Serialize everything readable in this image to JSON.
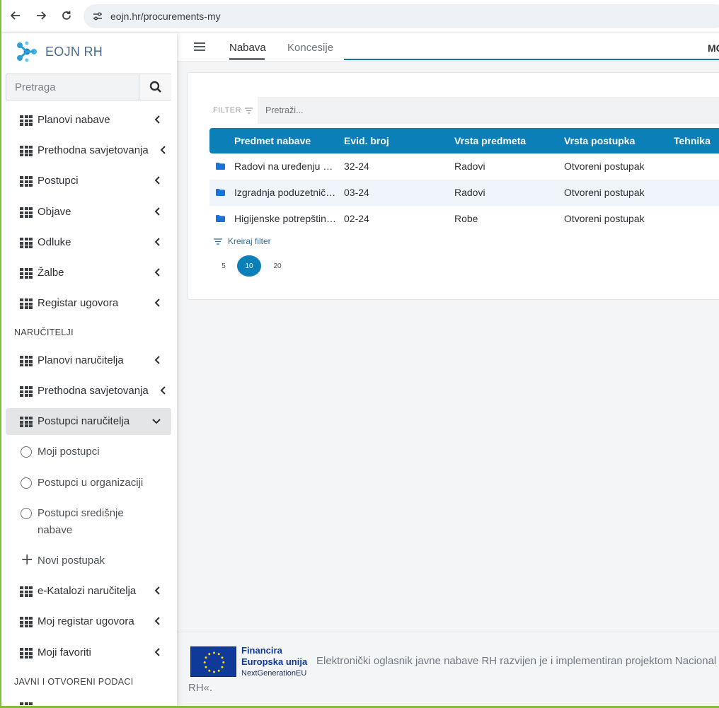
{
  "browser": {
    "url": "eojn.hr/procurements-my"
  },
  "logo": {
    "text": "EOJN RH"
  },
  "search": {
    "placeholder": "Pretraga"
  },
  "sidebar": {
    "items": [
      {
        "label": "Planovi nabave"
      },
      {
        "label": "Prethodna savjetovanja"
      },
      {
        "label": "Postupci"
      },
      {
        "label": "Objave"
      },
      {
        "label": "Odluke"
      },
      {
        "label": "Žalbe"
      },
      {
        "label": "Registar ugovora"
      }
    ],
    "section_narucitelji": "NARUČITELJI",
    "narucitelji_items": [
      {
        "label": "Planovi naručitelja"
      },
      {
        "label": "Prethodna savjetovanja"
      },
      {
        "label": "Postupci naručitelja"
      }
    ],
    "sub_items": [
      {
        "label": "Moji postupci"
      },
      {
        "label": "Postupci u organizaciji"
      },
      {
        "label_line1": "Postupci središnje",
        "label_line2": "nabave"
      }
    ],
    "new_procedure": "Novi postupak",
    "more_items": [
      {
        "label": "e-Katalozi naručitelja"
      },
      {
        "label": "Moj registar ugovora"
      },
      {
        "label": "Moji favoriti"
      }
    ],
    "section_javni": "JAVNI I OTVORENI PODACI"
  },
  "topbar": {
    "tabs": [
      {
        "label": "Nabava"
      },
      {
        "label": "Koncesije"
      }
    ],
    "right_text": "MC"
  },
  "filter": {
    "label": "FILTER",
    "placeholder": "Pretraži..."
  },
  "table": {
    "headers": [
      "Predmet nabave",
      "Evid. broj",
      "Vrsta predmeta",
      "Vrsta postupka",
      "Tehnika"
    ],
    "rows": [
      {
        "subject": "Radovi na uređenju n…",
        "number": "32-24",
        "type": "Radovi",
        "procedure": "Otvoreni postupak"
      },
      {
        "subject": "Izgradnja poduzetnič…",
        "number": "03-24",
        "type": "Radovi",
        "procedure": "Otvoreni postupak"
      },
      {
        "subject": "Higijenske potrepštin…",
        "number": "02-24",
        "type": "Robe",
        "procedure": "Otvoreni postupak"
      }
    ]
  },
  "create_filter": "Kreiraj filter",
  "page_sizes": [
    "5",
    "10",
    "20"
  ],
  "selected_page_size": "10",
  "footer": {
    "eu_line1": "Financira",
    "eu_line2": "Europska unija",
    "eu_line3": "NextGenerationEU",
    "description": "Elektronički oglasnik javne nabave RH razvijen je i implementiran projektom Nacional",
    "description_cont": "RH«."
  },
  "colors": {
    "accent": "#0a7fb8",
    "frame": "#7bbf3a",
    "eu_blue": "#0f3a99"
  }
}
